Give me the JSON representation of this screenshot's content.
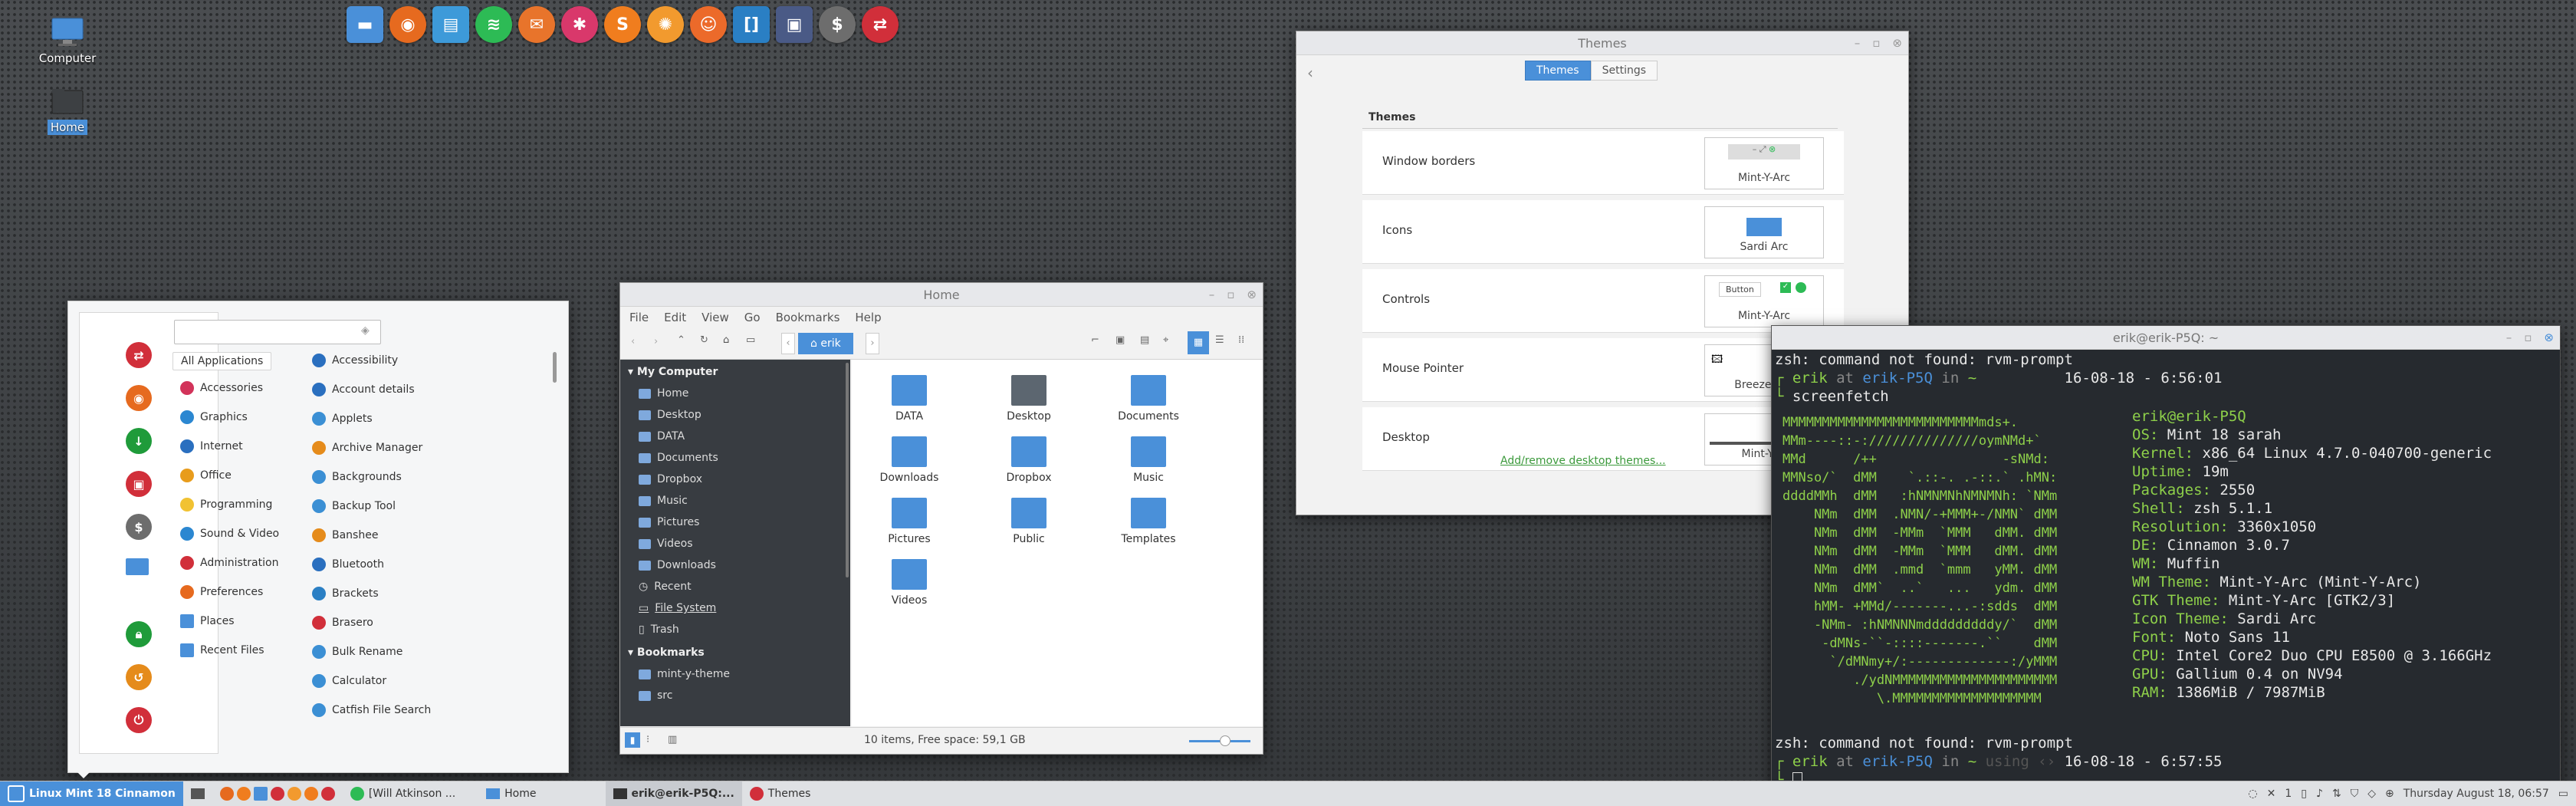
{
  "desktop": {
    "icons": [
      {
        "label": "Computer"
      },
      {
        "label": "Home"
      }
    ]
  },
  "dock": {
    "icons": [
      "files-icon",
      "firefox-icon",
      "notes-icon",
      "spotify-icon",
      "mail-icon",
      "settings-icon",
      "sublime-icon",
      "orange-icon",
      "user-icon",
      "bracket-icon",
      "screen-icon",
      "s-icon",
      "remmina-icon"
    ]
  },
  "menu": {
    "search_placeholder": "",
    "categories": [
      "All Applications",
      "Accessories",
      "Graphics",
      "Internet",
      "Office",
      "Programming",
      "Sound & Video",
      "Administration",
      "Preferences",
      "Places",
      "Recent Files"
    ],
    "apps": [
      "Accessibility",
      "Account details",
      "Applets",
      "Archive Manager",
      "Backgrounds",
      "Backup Tool",
      "Banshee",
      "Bluetooth",
      "Brackets",
      "Brasero",
      "Bulk Rename",
      "Calculator",
      "Catfish File Search"
    ]
  },
  "files": {
    "title": "Home",
    "menubar": [
      "File",
      "Edit",
      "View",
      "Go",
      "Bookmarks",
      "Help"
    ],
    "path_button": "erik",
    "sidebar": {
      "computer_header": "My Computer",
      "computer_items": [
        "Home",
        "Desktop",
        "DATA",
        "Documents",
        "Dropbox",
        "Music",
        "Pictures",
        "Videos",
        "Downloads",
        "Recent",
        "File System",
        "Trash"
      ],
      "bookmarks_header": "Bookmarks",
      "bookmark_items": [
        "mint-y-theme",
        "src"
      ]
    },
    "items": [
      "DATA",
      "Desktop",
      "Documents",
      "Downloads",
      "Dropbox",
      "Music",
      "Pictures",
      "Public",
      "Templates",
      "Videos"
    ],
    "status": "10 items, Free space: 59,1 GB"
  },
  "themes": {
    "title": "Themes",
    "tabs": [
      "Themes",
      "Settings"
    ],
    "section": "Themes",
    "rows": [
      {
        "label": "Window borders",
        "value": "Mint-Y-Arc"
      },
      {
        "label": "Icons",
        "value": "Sardi Arc"
      },
      {
        "label": "Controls",
        "value": "Mint-Y-Arc"
      },
      {
        "label": "Mouse Pointer",
        "value": "Breeze_S..."
      },
      {
        "label": "Desktop",
        "value": "Mint-Y-..."
      }
    ],
    "controls_button_label": "Button",
    "add_remove_link": "Add/remove desktop themes..."
  },
  "terminal": {
    "title": "erik@erik-P5Q: ~",
    "line1": "zsh: command not found: rvm-prompt",
    "prompt_user": "erik",
    "prompt_at": " at ",
    "prompt_host": "erik-P5Q",
    "prompt_in": " in ",
    "prompt_dir": "~",
    "prompt_time1": "16-08-18 - 6:56:01",
    "cmd": "screenfetch",
    "user_host": "erik@erik-P5Q",
    "info": [
      {
        "k": "OS:",
        "v": " Mint 18 sarah"
      },
      {
        "k": "Kernel:",
        "v": " x86_64 Linux 4.7.0-040700-generic"
      },
      {
        "k": "Uptime:",
        "v": " 19m"
      },
      {
        "k": "Packages:",
        "v": " 2550"
      },
      {
        "k": "Shell:",
        "v": " zsh 5.1.1"
      },
      {
        "k": "Resolution:",
        "v": " 3360x1050"
      },
      {
        "k": "DE:",
        "v": " Cinnamon 3.0.7"
      },
      {
        "k": "WM:",
        "v": " Muffin"
      },
      {
        "k": "WM Theme:",
        "v": " Mint-Y-Arc (Mint-Y-Arc)"
      },
      {
        "k": "GTK Theme:",
        "v": " Mint-Y-Arc [GTK2/3]"
      },
      {
        "k": "Icon Theme:",
        "v": " Sardi Arc"
      },
      {
        "k": "Font:",
        "v": " Noto Sans 11"
      },
      {
        "k": "CPU:",
        "v": " Intel Core2 Duo CPU E8500 @ 3.166GHz"
      },
      {
        "k": "GPU:",
        "v": " Gallium 0.4 on NV94"
      },
      {
        "k": "RAM:",
        "v": " 1386MiB / 7987MiB"
      }
    ],
    "line_err2": "zsh: command not found: rvm-prompt",
    "prompt_git": "using ‹›",
    "prompt_time2": "16-08-18 - 6:57:55"
  },
  "taskbar": {
    "menu_label": "Linux Mint 18 Cinnamon",
    "windows": [
      "[Will Atkinson ...",
      "Home",
      "erik@erik-P5Q:...",
      "Themes"
    ],
    "workspace": "1",
    "clock": "Thursday August 18, 06:57"
  },
  "colors": {
    "accent": "#4a90d9",
    "terminal_green": "#8ed04a",
    "terminal_bg": "#262a2f",
    "sidebar_bg": "#383c41"
  }
}
